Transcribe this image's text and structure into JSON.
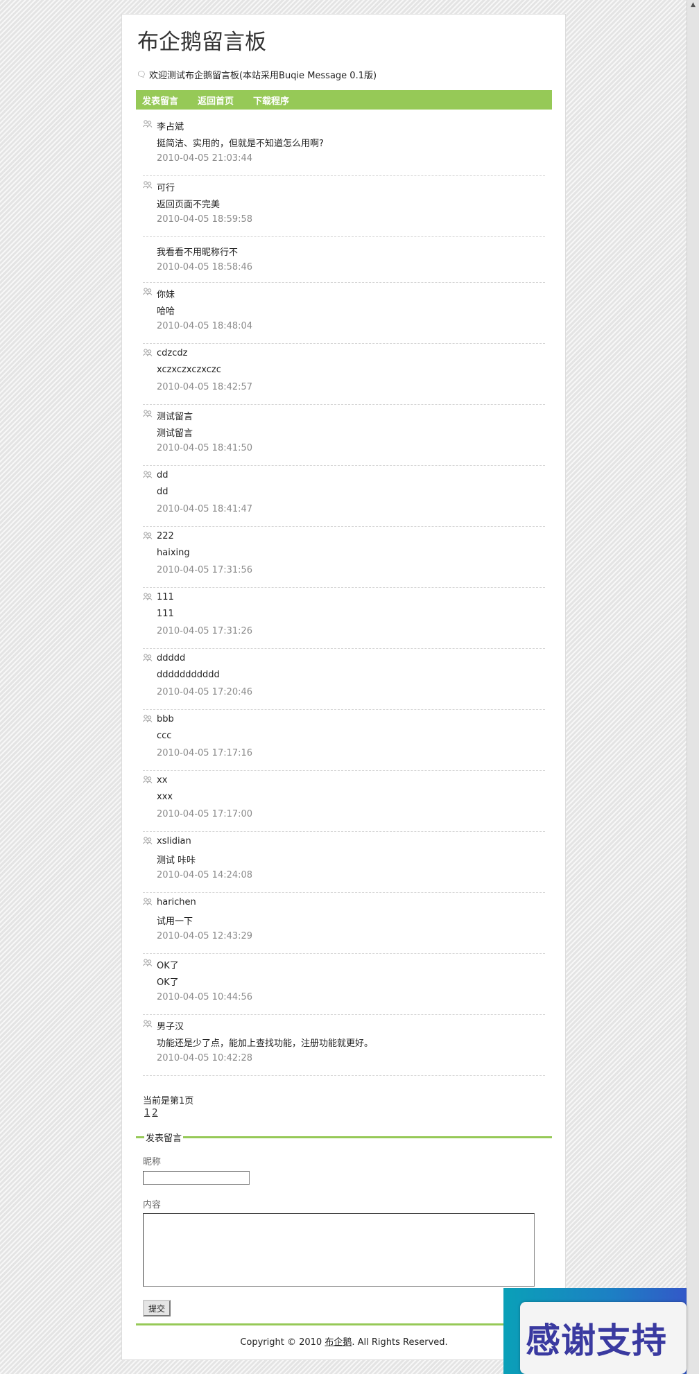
{
  "header": {
    "title": "布企鹅留言板",
    "welcome": "欢迎测试布企鹅留言板(本站采用Buqie Message 0.1版)"
  },
  "nav": {
    "items": [
      "发表留言",
      "返回首页",
      "下载程序"
    ]
  },
  "messages": [
    {
      "author": "李占斌",
      "content": "挺简洁、实用的，但就是不知道怎么用啊?",
      "time": "2010-04-05 21:03:44"
    },
    {
      "author": "可行",
      "content": "返回页面不完美",
      "time": "2010-04-05 18:59:58"
    },
    {
      "author": "",
      "content": "我看看不用昵称行不",
      "time": "2010-04-05 18:58:46"
    },
    {
      "author": "你妹",
      "content": "哈哈",
      "time": "2010-04-05 18:48:04"
    },
    {
      "author": "cdzcdz",
      "content": "xczxczxczxczc",
      "time": "2010-04-05 18:42:57"
    },
    {
      "author": "测试留言",
      "content": "测试留言",
      "time": "2010-04-05 18:41:50"
    },
    {
      "author": "dd",
      "content": "dd",
      "time": "2010-04-05 18:41:47"
    },
    {
      "author": "222",
      "content": "haixing",
      "time": "2010-04-05 17:31:56"
    },
    {
      "author": "111",
      "content": "111",
      "time": "2010-04-05 17:31:26"
    },
    {
      "author": "ddddd",
      "content": "ddddddddddd",
      "time": "2010-04-05 17:20:46"
    },
    {
      "author": "bbb",
      "content": "ccc",
      "time": "2010-04-05 17:17:16"
    },
    {
      "author": "xx",
      "content": "xxx",
      "time": "2010-04-05 17:17:00"
    },
    {
      "author": "xslidian",
      "content": "测试 咔咔",
      "time": "2010-04-05 14:24:08"
    },
    {
      "author": "harichen",
      "content": "试用一下",
      "time": "2010-04-05 12:43:29"
    },
    {
      "author": "OK了",
      "content": "OK了",
      "time": "2010-04-05 10:44:56"
    },
    {
      "author": "男子汉",
      "content": "功能还是少了点，能加上查找功能，注册功能就更好。",
      "time": "2010-04-05 10:42:28"
    }
  ],
  "pager": {
    "current": "当前是第1页",
    "pages": [
      "1",
      "2"
    ]
  },
  "form": {
    "legend": "发表留言",
    "nickname_label": "昵称",
    "nickname_value": "",
    "content_label": "内容",
    "content_value": "",
    "submit_label": "提交"
  },
  "footer": {
    "copyright_prefix": "Copyright © 2010 ",
    "copyright_link": "布企鹅",
    "copyright_suffix": ". All Rights Reserved."
  },
  "banner": {
    "text": "感谢支持"
  },
  "colors": {
    "accent_green": "#96c957",
    "time_gray": "#8a8a8a",
    "banner_blue": "#1d7fc4"
  },
  "icons": {
    "welcome": "speech-bubble-icon",
    "author": "users-icon"
  }
}
